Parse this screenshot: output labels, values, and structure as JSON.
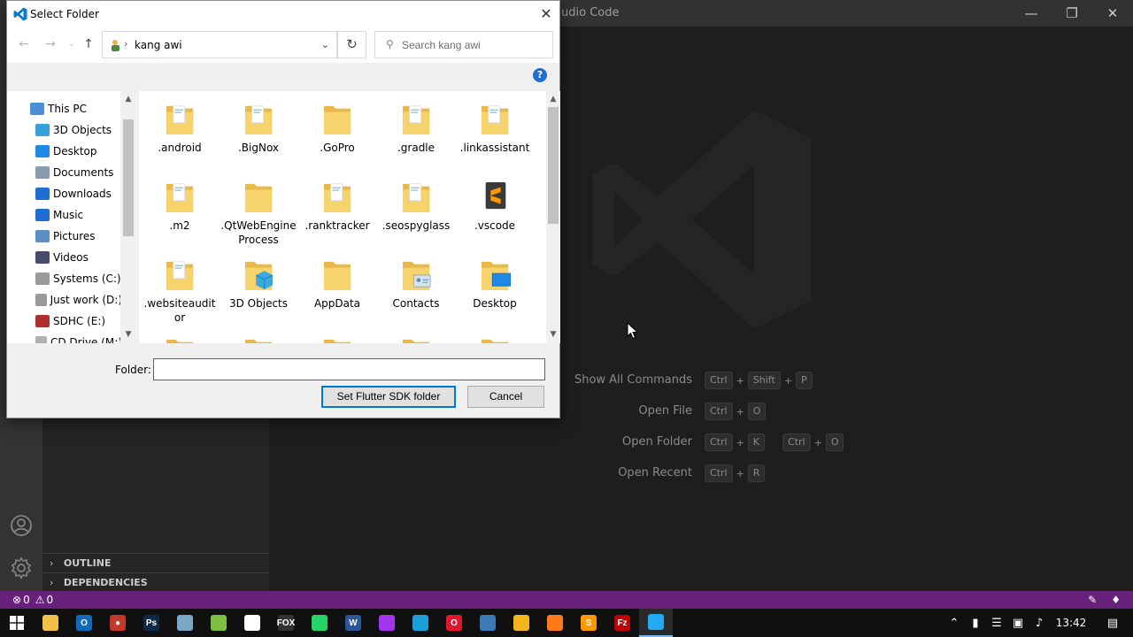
{
  "vscode": {
    "title_partial": "udio Code",
    "shortcuts": [
      {
        "label": "Show All Commands",
        "keys": [
          [
            "Ctrl",
            "Shift",
            "P"
          ]
        ]
      },
      {
        "label": "Open File",
        "keys": [
          [
            "Ctrl",
            "O"
          ]
        ]
      },
      {
        "label": "Open Folder",
        "keys": [
          [
            "Ctrl",
            "K"
          ],
          [
            "Ctrl",
            "O"
          ]
        ]
      },
      {
        "label": "Open Recent",
        "keys": [
          [
            "Ctrl",
            "R"
          ]
        ]
      }
    ],
    "sidebar_sections": [
      "OUTLINE",
      "DEPENDENCIES"
    ],
    "status": {
      "errors": "0",
      "warnings": "0"
    },
    "colors": {
      "statusbar": "#68217a",
      "editor_bg": "#1e1e1e"
    }
  },
  "dialog": {
    "title": "Select Folder",
    "address": "kang awi",
    "search_placeholder": "Search kang awi",
    "help": "?",
    "nav_items": [
      {
        "label": "This PC",
        "icon": "pc-icon"
      },
      {
        "label": "3D Objects",
        "icon": "3d-objects-icon"
      },
      {
        "label": "Desktop",
        "icon": "desktop-icon"
      },
      {
        "label": "Documents",
        "icon": "documents-icon"
      },
      {
        "label": "Downloads",
        "icon": "downloads-icon"
      },
      {
        "label": "Music",
        "icon": "music-icon"
      },
      {
        "label": "Pictures",
        "icon": "pictures-icon"
      },
      {
        "label": "Videos",
        "icon": "videos-icon"
      },
      {
        "label": "Systems (C:)",
        "icon": "drive-icon"
      },
      {
        "label": "Just work (D:)",
        "icon": "drive-icon"
      },
      {
        "label": "SDHC (E:)",
        "icon": "sd-card-icon"
      },
      {
        "label": "CD Drive (M:)",
        "icon": "cd-drive-icon"
      }
    ],
    "files": [
      {
        "name": ".android",
        "icon": "folder-doc-icon"
      },
      {
        "name": ".BigNox",
        "icon": "folder-doc-icon"
      },
      {
        "name": ".GoPro",
        "icon": "folder-icon"
      },
      {
        "name": ".gradle",
        "icon": "folder-doc-icon"
      },
      {
        "name": ".linkassistant",
        "icon": "folder-doc-icon"
      },
      {
        "name": ".m2",
        "icon": "folder-doc-icon"
      },
      {
        "name": ".QtWebEngineProcess",
        "icon": "folder-icon"
      },
      {
        "name": ".ranktracker",
        "icon": "folder-doc-icon"
      },
      {
        "name": ".seospyglass",
        "icon": "folder-doc-icon"
      },
      {
        "name": ".vscode",
        "icon": "sublime-folder-icon"
      },
      {
        "name": ".websiteauditor",
        "icon": "folder-doc-icon"
      },
      {
        "name": "3D Objects",
        "icon": "3d-objects-folder-icon"
      },
      {
        "name": "AppData",
        "icon": "folder-icon"
      },
      {
        "name": "Contacts",
        "icon": "contacts-folder-icon"
      },
      {
        "name": "Desktop",
        "icon": "desktop-folder-icon"
      }
    ],
    "folder_label": "Folder:",
    "folder_value": "",
    "primary_button": "Set Flutter SDK folder",
    "cancel_button": "Cancel"
  },
  "taskbar": {
    "time": "13:42",
    "apps": [
      {
        "name": "file-explorer",
        "color": "#f1c04a",
        "glyph": ""
      },
      {
        "name": "outlook",
        "color": "#0f6cbd",
        "glyph": "O"
      },
      {
        "name": "recorder",
        "color": "#c0392b",
        "glyph": "●"
      },
      {
        "name": "photoshop",
        "color": "#0b2a4a",
        "glyph": "Ps"
      },
      {
        "name": "app-generic",
        "color": "#7aa7c7",
        "glyph": ""
      },
      {
        "name": "notepad-plus",
        "color": "#7ebf3f",
        "glyph": ""
      },
      {
        "name": "app-circle",
        "color": "#ffffff",
        "glyph": ""
      },
      {
        "name": "foxit",
        "color": "#333333",
        "glyph": "FOX"
      },
      {
        "name": "whatsapp",
        "color": "#25d366",
        "glyph": ""
      },
      {
        "name": "word",
        "color": "#2b579a",
        "glyph": "W"
      },
      {
        "name": "messenger",
        "color": "#a335ee",
        "glyph": ""
      },
      {
        "name": "edge",
        "color": "#1a9fd8",
        "glyph": ""
      },
      {
        "name": "opera",
        "color": "#e0162b",
        "glyph": "O"
      },
      {
        "name": "app-blue",
        "color": "#3d7ab8",
        "glyph": ""
      },
      {
        "name": "chrome",
        "color": "#f2b51c",
        "glyph": ""
      },
      {
        "name": "firefox",
        "color": "#ff7a18",
        "glyph": ""
      },
      {
        "name": "sublime",
        "color": "#ff9800",
        "glyph": "S"
      },
      {
        "name": "filezilla",
        "color": "#bf0000",
        "glyph": "Fz"
      },
      {
        "name": "vscode",
        "color": "#23a9f2",
        "glyph": ""
      }
    ]
  }
}
